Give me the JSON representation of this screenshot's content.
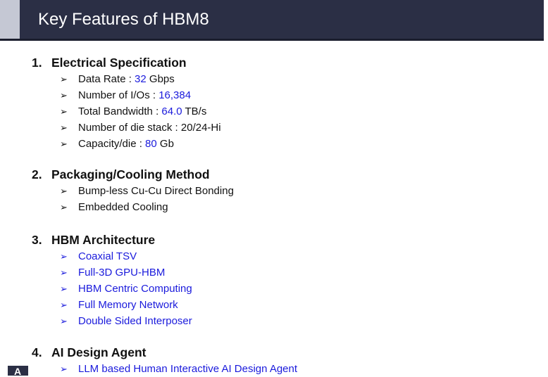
{
  "header": {
    "title": "Key Features of HBM8"
  },
  "sections": [
    {
      "number": "1.",
      "title": "Electrical Specification",
      "items": [
        {
          "label": "Data Rate : ",
          "value": "32",
          "unit": " Gbps"
        },
        {
          "label": "Number of I/Os : ",
          "value": "16,384",
          "unit": ""
        },
        {
          "label": "Total Bandwidth : ",
          "value": "64.0",
          "unit": " TB/s"
        },
        {
          "label": "Number of die stack : 20/24-Hi"
        },
        {
          "label": "Capacity/die : ",
          "value": "80",
          "unit": " Gb"
        }
      ]
    },
    {
      "number": "2.",
      "title": "Packaging/Cooling Method",
      "items": [
        {
          "label": "Bump-less Cu-Cu Direct Bonding"
        },
        {
          "label": "Embedded Cooling"
        }
      ]
    },
    {
      "number": "3.",
      "title": "HBM Architecture",
      "items": [
        {
          "label": "Coaxial TSV"
        },
        {
          "label": "Full-3D GPU-HBM"
        },
        {
          "label": "HBM Centric Computing"
        },
        {
          "label": "Full Memory Network"
        },
        {
          "label": "Double Sided Interposer"
        }
      ]
    },
    {
      "number": "4.",
      "title": "AI Design Agent",
      "items": [
        {
          "label": "LLM based Human Interactive AI Design Agent"
        }
      ]
    }
  ],
  "bullet_glyph": "➢",
  "corner_logo_text": "A",
  "colors": {
    "title_bar": "#2b2f45",
    "accent": "#c5c8d4",
    "highlight_blue": "#1a1adc",
    "text": "#111111"
  }
}
